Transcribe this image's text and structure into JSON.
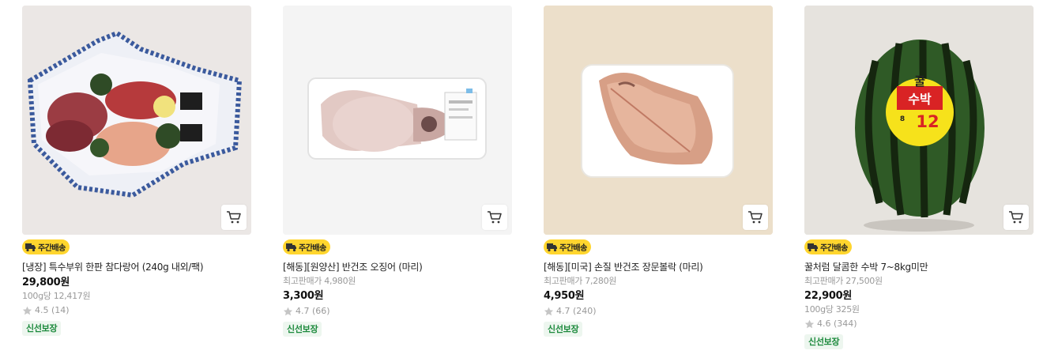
{
  "colors": {
    "badge_bg": "#ffd52e",
    "fresh_text": "#1d8a3d",
    "fresh_bg": "#edf6ef",
    "muted_text": "#999999"
  },
  "products": [
    {
      "badge": "주간배송",
      "name": "[냉장] 특수부위 한판 참다랑어 (240g 내외/팩)",
      "price": "29,800원",
      "unit_price": "100g당 12,417원",
      "rating": "4.5 (14)",
      "tag": "신선보장",
      "image_icon": "tuna-platter-image",
      "cart_icon": "cart-icon"
    },
    {
      "badge": "주간배송",
      "name": "[해동][원양산] 반건조 오징어 (마리)",
      "original_price": "최고판매가 4,980원",
      "price": "3,300원",
      "rating": "4.7 (66)",
      "tag": "신선보장",
      "image_icon": "squid-tray-image",
      "cart_icon": "cart-icon"
    },
    {
      "badge": "주간배송",
      "name": "[해동][미국] 손질 반건조 장문볼락 (마리)",
      "original_price": "최고판매가 7,280원",
      "price": "4,950원",
      "rating": "4.7 (240)",
      "tag": "신선보장",
      "image_icon": "dried-fish-tray-image",
      "cart_icon": "cart-icon"
    },
    {
      "badge": "주간배송",
      "name": "꿀처럼 달콤한 수박 7~8kg미만",
      "original_price": "최고판매가 27,500원",
      "price": "22,900원",
      "unit_price": "100g당 325원",
      "rating": "4.6 (344)",
      "tag": "신선보장",
      "image_icon": "watermelon-image",
      "sticker_top": "꿀",
      "sticker_main": "수박",
      "sticker_num": "12",
      "sticker_left": "8",
      "cart_icon": "cart-icon"
    }
  ]
}
